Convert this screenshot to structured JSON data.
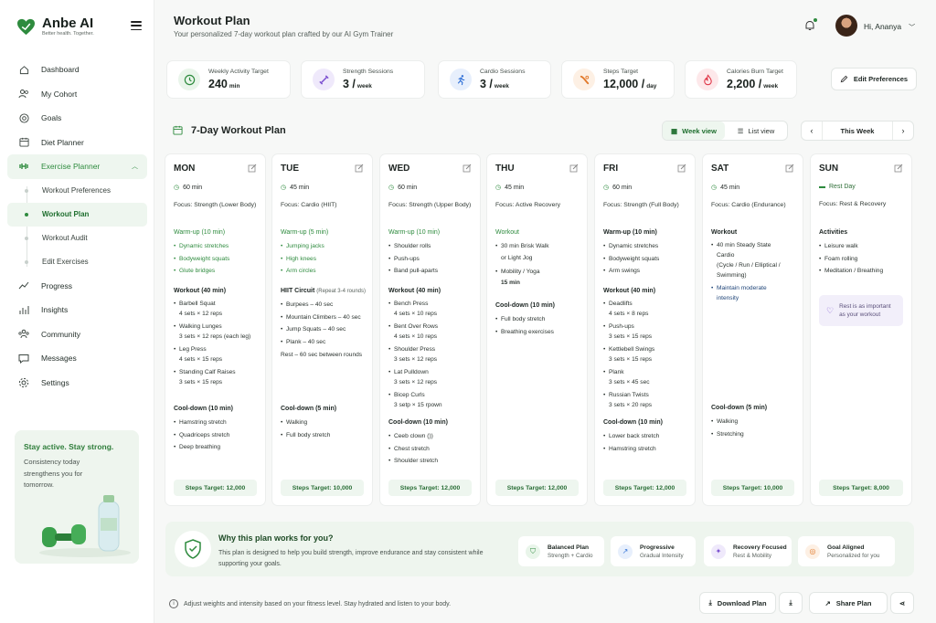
{
  "brand": {
    "name": "Anbe AI",
    "tagline": "Better health. Together."
  },
  "nav": [
    {
      "label": "Dashboard",
      "icon": "home-icon"
    },
    {
      "label": "My Cohort",
      "icon": "users-icon"
    },
    {
      "label": "Goals",
      "icon": "target-icon"
    },
    {
      "label": "Diet Planner",
      "icon": "calendar-icon"
    },
    {
      "label": "Exercise Planner",
      "icon": "dumbbell-icon"
    },
    {
      "label": "Progress",
      "icon": "trend-icon"
    },
    {
      "label": "Insights",
      "icon": "insights-icon"
    },
    {
      "label": "Community",
      "icon": "community-icon"
    },
    {
      "label": "Messages",
      "icon": "message-icon"
    },
    {
      "label": "Settings",
      "icon": "gear-icon"
    }
  ],
  "subnav": [
    "Workout Preferences",
    "Workout Plan",
    "Workout Audit",
    "Edit Exercises"
  ],
  "promo": {
    "title": "Stay active. Stay strong.",
    "text": "Consistency today strengthens you for tomorrow."
  },
  "header": {
    "title": "Workout Plan",
    "subtitle": "Your personalized 7-day workout plan crafted by our AI Gym Trainer",
    "greeting": "Hi, Ananya"
  },
  "stats": [
    {
      "label": "Weekly Activity Target",
      "value": "240",
      "unit": "min",
      "color": "#2e8b3e",
      "bg": "#e9f5ea"
    },
    {
      "label": "Strength Sessions",
      "value": "3 /",
      "unit": "week",
      "color": "#7b4fd0",
      "bg": "#efe9fb"
    },
    {
      "label": "Cardio Sessions",
      "value": "3 /",
      "unit": "week",
      "color": "#2f6fd6",
      "bg": "#e7effc"
    },
    {
      "label": "Steps Target",
      "value": "12,000 /",
      "unit": "day",
      "color": "#e27a2c",
      "bg": "#fdf0e4"
    },
    {
      "label": "Calories Burn Target",
      "value": "2,200 /",
      "unit": "week",
      "color": "#e0394a",
      "bg": "#fde8ea"
    }
  ],
  "edit_pref": "Edit Preferences",
  "plan_title": "7-Day Workout Plan",
  "view": {
    "week": "Week view",
    "list": "List view"
  },
  "week_label": "This Week",
  "days": [
    {
      "name": "MON",
      "dur": "60 min",
      "focus": "Focus: Strength (Lower Body)",
      "steps": "Steps Target: 12,000",
      "wh": "Warm-up (10 min)",
      "w": [
        "Dynamic stretches",
        "Bodyweight squats",
        "Glute bridges"
      ],
      "mh": "Workout (40 min)",
      "m": [
        [
          "Barbell Squat",
          "4 sets × 12 reps"
        ],
        [
          "Walking Lunges",
          "3 sets × 12 reps (each leg)"
        ],
        [
          "Leg Press",
          "4 sets × 15 reps"
        ],
        [
          "Standing Calf Raises",
          "3 sets × 15 reps"
        ]
      ],
      "ch": "Cool-down (10 min)",
      "c": [
        "Hamstring stretch",
        "Quadriceps stretch",
        "Deep breathing"
      ]
    },
    {
      "name": "TUE",
      "dur": "45 min",
      "focus": "Focus: Cardio (HIIT)",
      "steps": "Steps Target: 10,000",
      "wh": "Warm-up (5 min)",
      "w": [
        "Jumping jacks",
        "High knees",
        "Arm circles"
      ],
      "mh": "HIIT Circuit",
      "mh2": "(Repeat 3-4 rounds)",
      "m": [
        "Burpees – 40 sec",
        "Mountain Climbers – 40 sec",
        "Jump Squats – 40 sec",
        "Plank – 40 sec"
      ],
      "rest": "Rest – 60 sec between rounds",
      "ch": "Cool-down (5 min)",
      "c": [
        "Walking",
        "Full body stretch"
      ]
    },
    {
      "name": "WED",
      "dur": "60 min",
      "focus": "Focus: Strength (Upper Body)",
      "steps": "Steps Target: 12,000",
      "wh": "Warm-up (10 min)",
      "w": [
        "Shoulder rolls",
        "Push-ups",
        "Band pull-aparts"
      ],
      "mh": "Workout (40 min)",
      "m": [
        [
          "Bench Press",
          "4 sets × 10 reps"
        ],
        [
          "Bent Over Rows",
          "4 sets × 10 reps"
        ],
        [
          "Shoulder Press",
          "3 sets × 12 reps"
        ],
        [
          "Lat Pulldown",
          "3 sets × 12 reps"
        ],
        [
          "Bicep Curls",
          "3 setp × 15 rpown"
        ]
      ],
      "ch": "Cool-down (10 min)",
      "c": [
        "Ceeb clown ())",
        "Chest stretch",
        "Shoulder stretch"
      ]
    },
    {
      "name": "THU",
      "dur": "45 min",
      "focus": "Focus: Active Recovery",
      "steps": "Steps Target: 12,000",
      "wh": "Workout",
      "w": [
        "30 min Brisk Walk",
        "or Light Jog",
        "Mobility / Yoga",
        "15 min"
      ],
      "ch": "Cool-down (10 min)",
      "c": [
        "Full body stretch",
        "Breathing exercises"
      ]
    },
    {
      "name": "FRI",
      "dur": "60 min",
      "focus": "Focus: Strength (Full Body)",
      "steps": "Steps Target: 12,000",
      "wh": "Warm-up (10 min)",
      "w": [
        "Dynamic stretches",
        "Bodyweight squats",
        "Arm swings"
      ],
      "mh": "Workout (40 min)",
      "m": [
        [
          "Deadlifts",
          "4 sets × 8 reps"
        ],
        [
          "Push-ups",
          "3 sets × 15 reps"
        ],
        [
          "Kettlebell Swings",
          "3 sets × 15 reps"
        ],
        [
          "Plank",
          "3 sets × 45 sec"
        ],
        [
          "Russian Twists",
          "3 sets × 20 reps"
        ]
      ],
      "ch": "Cool-down (10 min)",
      "c": [
        "Lower back stretch",
        "Hamstring stretch"
      ]
    },
    {
      "name": "SAT",
      "dur": "45 min",
      "focus": "Focus: Cardio (Endurance)",
      "steps": "Steps Target: 10,000",
      "wh": "Workout",
      "w": [
        "40 min Steady State",
        "Cardio",
        "(Cycle / Run / Elliptical /",
        "Swimming)",
        "Maintain moderate",
        "intensity"
      ],
      "ch": "Cool-down (5 min)",
      "c": [
        "Walking",
        "Stretching"
      ]
    },
    {
      "name": "SUN",
      "dur": "Rest Day",
      "focus": "Focus: Rest & Recovery",
      "steps": "Steps Target: 8,000",
      "wh": "Activities",
      "w": [
        "Leisure walk",
        "Foam rolling",
        "Meditation / Breathing"
      ],
      "note": [
        "Rest is as important",
        "as your workout"
      ]
    }
  ],
  "why": {
    "title": "Why this plan works for you?",
    "text": "This plan is designed to help you build strength, improve endurance and stay consistent while supporting your goals."
  },
  "features": [
    {
      "t": "Balanced Plan",
      "s": "Strength + Cardio",
      "color": "#2e8b3e",
      "bg": "#e9f5ea"
    },
    {
      "t": "Progressive",
      "s": "Gradual Intensity",
      "color": "#2f6fd6",
      "bg": "#e7effc"
    },
    {
      "t": "Recovery Focused",
      "s": "Rest & Mobility",
      "color": "#7b4fd0",
      "bg": "#efe9fb"
    },
    {
      "t": "Goal Aligned",
      "s": "Personalized for you",
      "color": "#e27a2c",
      "bg": "#fdf0e4"
    }
  ],
  "footer": {
    "info": "Adjust weights and intensity based on your fitness level. Stay hydrated and listen to your body.",
    "download": "Download Plan",
    "share": "Share Plan"
  }
}
